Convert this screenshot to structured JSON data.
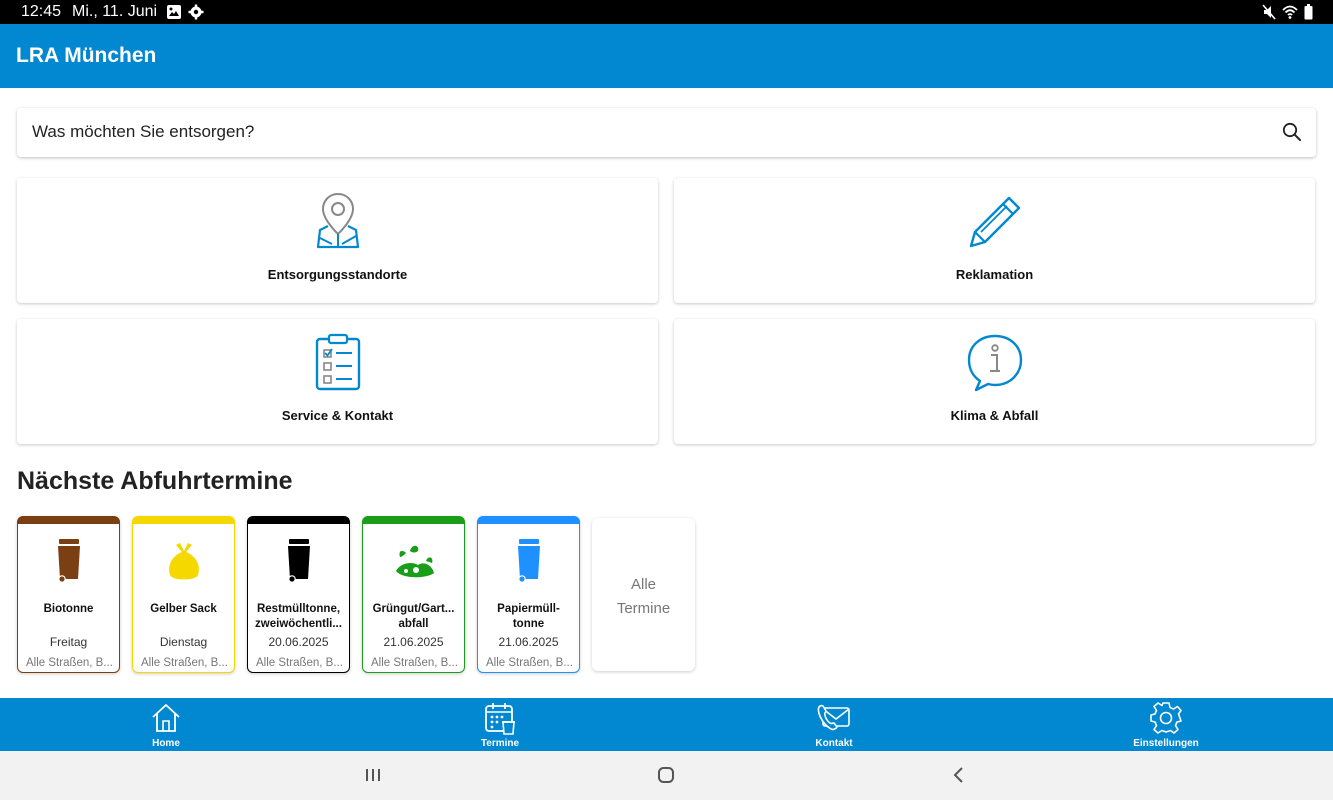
{
  "status_bar": {
    "time": "12:45",
    "date": "Mi., 11. Juni"
  },
  "app_bar": {
    "title": "LRA München"
  },
  "search": {
    "placeholder": "Was möchten Sie entsorgen?"
  },
  "tiles": [
    {
      "label": "Entsorgungsstandorte",
      "icon": "map-pin-icon"
    },
    {
      "label": "Reklamation",
      "icon": "pencil-icon"
    },
    {
      "label": "Service & Kontakt",
      "icon": "clipboard-checklist-icon"
    },
    {
      "label": "Klima & Abfall",
      "icon": "info-bubble-icon"
    }
  ],
  "schedule": {
    "title": "Nächste Abfuhrtermine",
    "cards": [
      {
        "name": "Biotonne",
        "date": "Freitag",
        "street": "Alle Straßen, B...",
        "color": "#7b3f14",
        "icon": "bin-icon"
      },
      {
        "name": "Gelber Sack",
        "date": "Dienstag",
        "street": "Alle Straßen, B...",
        "color": "#f5d800",
        "icon": "yellow-bag-icon"
      },
      {
        "name": "Restmülltonne, zweiwöchentli...",
        "date": "20.06.2025",
        "street": "Alle Straßen, B...",
        "color": "#000000",
        "icon": "bin-icon"
      },
      {
        "name": "Grüngut/Gart... abfall",
        "date": "21.06.2025",
        "street": "Alle Straßen, B...",
        "color": "#1a9e1a",
        "icon": "green-waste-icon"
      },
      {
        "name": "Papiermüll-tonne",
        "date": "21.06.2025",
        "street": "Alle Straßen, B...",
        "color": "#1e90ff",
        "icon": "bin-icon"
      }
    ],
    "all_label": "Alle Termine"
  },
  "bottom_nav": [
    {
      "label": "Home",
      "icon": "home-icon"
    },
    {
      "label": "Termine",
      "icon": "calendar-icon"
    },
    {
      "label": "Kontakt",
      "icon": "phone-icon"
    },
    {
      "label": "Einstellungen",
      "icon": "gear-icon"
    }
  ],
  "colors": {
    "primary": "#0288d1",
    "icon_blue": "#0288d1"
  }
}
